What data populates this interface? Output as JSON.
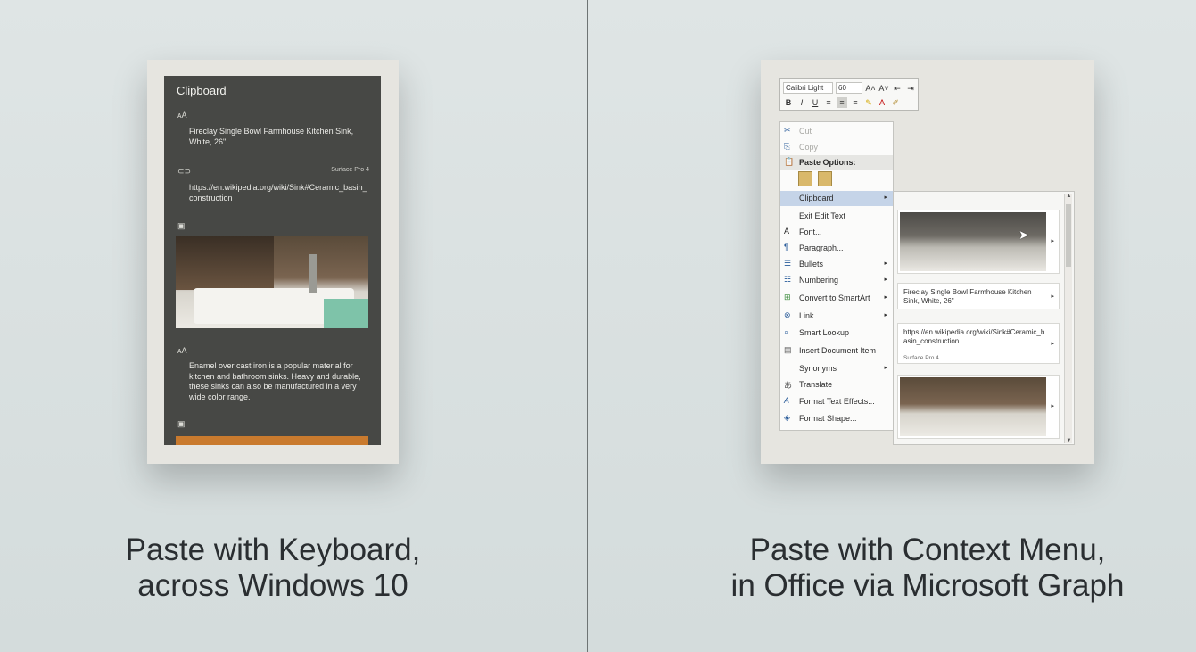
{
  "left": {
    "caption_line1": "Paste with Keyboard,",
    "caption_line2": "across Windows 10",
    "clipboard": {
      "title": "Clipboard",
      "items": [
        {
          "icon": "text-icon",
          "icon_glyph": "ᴀA",
          "text": "Fireclay Single Bowl Farmhouse Kitchen Sink, White, 26\""
        },
        {
          "icon": "link-icon",
          "icon_glyph": "⊂⊃",
          "text": "https://en.wikipedia.org/wiki/Sink#Ceramic_basin_construction",
          "meta": "Surface Pro 4"
        },
        {
          "icon": "image-icon",
          "icon_glyph": "▣"
        },
        {
          "icon": "text-icon",
          "icon_glyph": "ᴀA",
          "text": "Enamel over cast iron is a popular material for kitchen and bathroom sinks. Heavy and durable, these sinks can also be manufactured in a very wide color range."
        },
        {
          "icon": "image-icon",
          "icon_glyph": "▣"
        }
      ]
    }
  },
  "right": {
    "caption_line1": "Paste with Context Menu,",
    "caption_line2": "in Office via Microsoft Graph",
    "toolbar": {
      "font_name": "Calibri Light",
      "font_size": "60",
      "row1_buttons": [
        "A˄",
        "A˅"
      ],
      "row2_buttons": [
        "B",
        "I",
        "U"
      ]
    },
    "context_menu": {
      "items": [
        {
          "label": "Cut",
          "icon": "scissors-icon",
          "glyph": "✂"
        },
        {
          "label": "Copy",
          "icon": "copy-icon",
          "glyph": "⎘"
        },
        {
          "label": "Paste Options:",
          "icon": "paste-icon",
          "glyph": "📋"
        },
        {
          "label": "Clipboard",
          "arrow": "▸"
        },
        {
          "label": "Exit Edit Text"
        },
        {
          "label": "Font...",
          "icon": "font-icon",
          "glyph": "A"
        },
        {
          "label": "Paragraph...",
          "icon": "paragraph-icon",
          "glyph": "¶"
        },
        {
          "label": "Bullets",
          "icon": "bullets-icon",
          "glyph": "☰",
          "arrow": "▸"
        },
        {
          "label": "Numbering",
          "icon": "numbering-icon",
          "glyph": "☷",
          "arrow": "▸"
        },
        {
          "label": "Convert to SmartArt",
          "icon": "smartart-icon",
          "glyph": "⊞",
          "arrow": "▸"
        },
        {
          "label": "Link",
          "icon": "link-icon",
          "glyph": "⊗",
          "arrow": "▸"
        },
        {
          "label": "Smart Lookup",
          "icon": "search-icon",
          "glyph": "⌕"
        },
        {
          "label": "Insert Document Item",
          "icon": "insert-icon",
          "glyph": "▤"
        },
        {
          "label": "Synonyms",
          "arrow": "▸"
        },
        {
          "label": "Translate",
          "icon": "translate-icon",
          "glyph": "あ"
        },
        {
          "label": "Format Text Effects...",
          "icon": "text-effects-icon",
          "glyph": "A"
        },
        {
          "label": "Format Shape...",
          "icon": "format-shape-icon",
          "glyph": "◈"
        }
      ]
    },
    "submenu": {
      "items": [
        {
          "type": "image"
        },
        {
          "type": "text",
          "text": "Fireclay Single Bowl Farmhouse Kitchen Sink, White, 26\""
        },
        {
          "type": "text",
          "text": "https://en.wikipedia.org/wiki/Sink#Ceramic_basin_construction",
          "meta": "Surface Pro 4"
        },
        {
          "type": "image"
        }
      ],
      "arrow": "▸",
      "scroll_up": "▲",
      "scroll_down": "▼"
    }
  }
}
